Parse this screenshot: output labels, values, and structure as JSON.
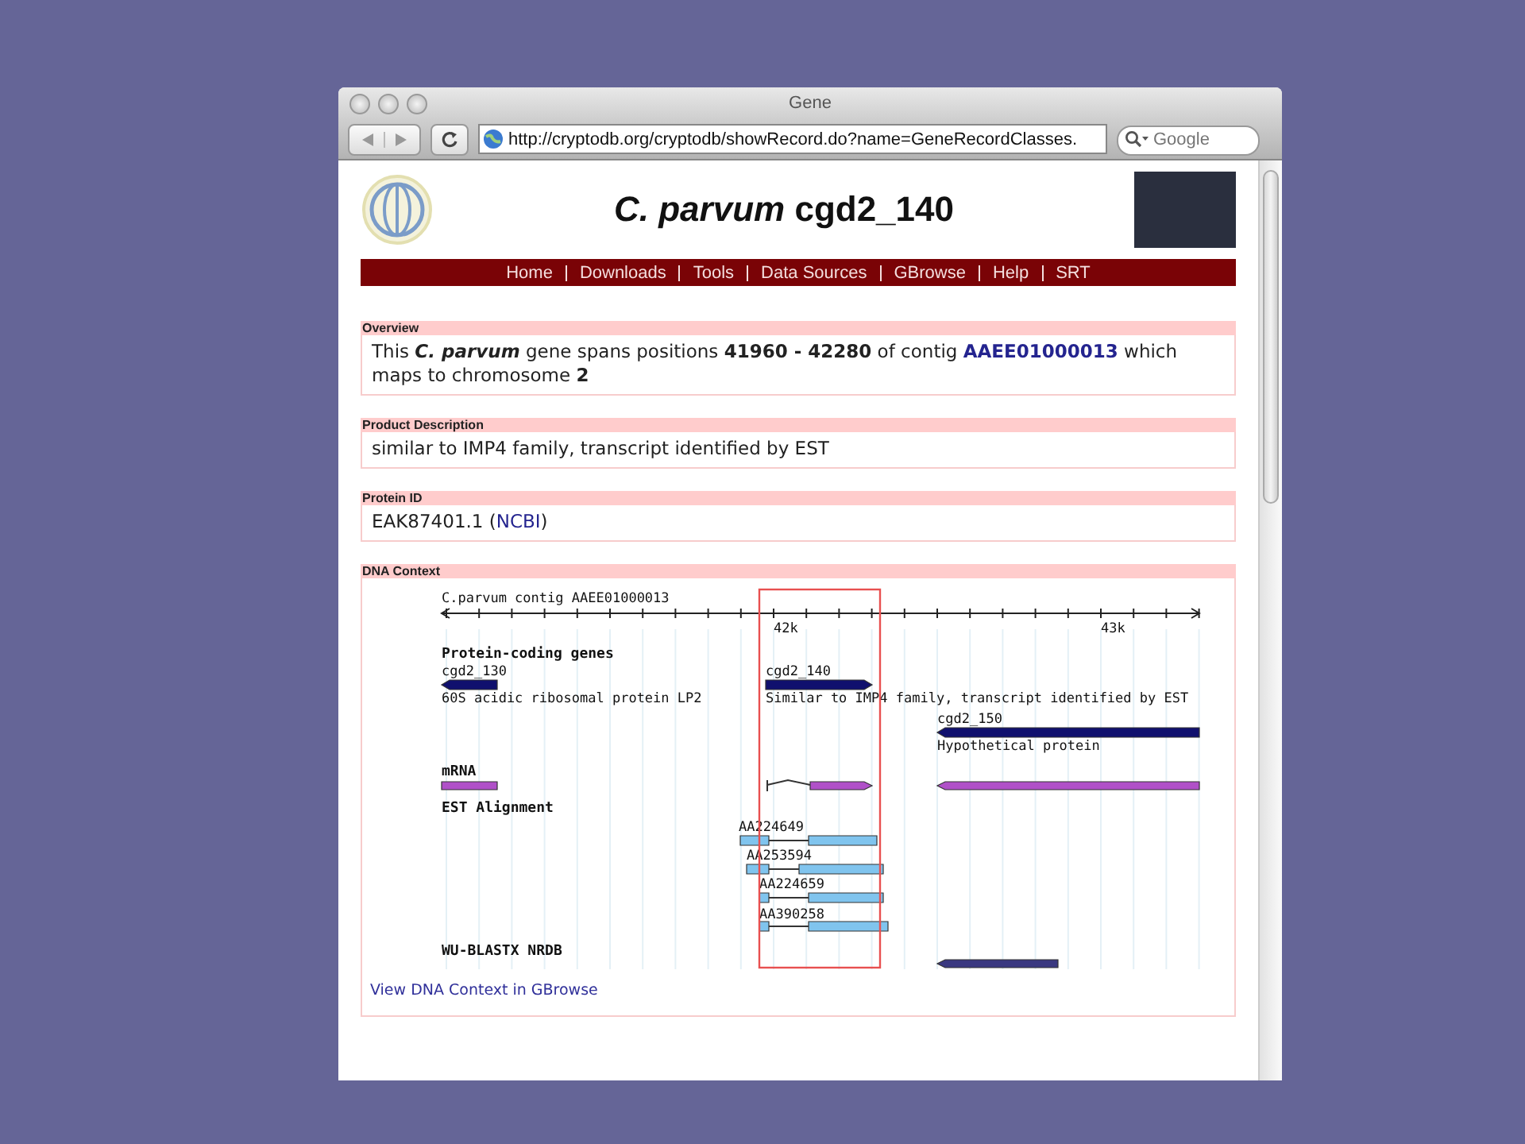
{
  "window": {
    "title": "Gene"
  },
  "toolbar": {
    "url": "http://cryptodb.org/cryptodb/showRecord.do?name=GeneRecordClasses.",
    "search_placeholder": "Google"
  },
  "page_title": "*C. parvum* cgd2_140",
  "nav": [
    "Home",
    "Downloads",
    "Tools",
    "Data Sources",
    "GBrowse",
    "Help",
    "SRT"
  ],
  "sections": [
    {
      "kind": "overview",
      "heading": "Overview",
      "before": "This *C. parvum* gene spans positions **41960 - 42280** of contig",
      "link": "AAEE01000013",
      "after": "which maps to chromosome **2**"
    },
    {
      "kind": "text",
      "heading": "Product Description",
      "text": "similar to IMP4 family, transcript identified by EST"
    },
    {
      "kind": "protein",
      "heading": "Protein ID",
      "before": "EAK87401.1 (",
      "link": "NCBI",
      "after": ")"
    },
    {
      "kind": "dna",
      "heading": "DNA Context",
      "contig": "C.parvum contig AAEE01000013",
      "axis_labels": [
        "42k",
        "43k"
      ],
      "tracks": [
        {
          "kind": "genes",
          "title": "Protein-coding genes",
          "features": [
            {
              "name": "cgd2_130",
              "description": "60S acidic ribosomal protein LP2"
            },
            {
              "name": "cgd2_140",
              "description": "Similar to IMP4 family, transcript identified by EST"
            },
            {
              "name": "cgd2_150",
              "description": "Hypothetical protein"
            }
          ]
        },
        {
          "kind": "mrna",
          "title": "mRNA"
        },
        {
          "kind": "est",
          "title": "EST Alignment",
          "features": [
            {
              "name": "AA224649"
            },
            {
              "name": "AA253594"
            },
            {
              "name": "AA224659"
            },
            {
              "name": "AA390258"
            }
          ]
        },
        {
          "kind": "blast",
          "title": "WU-BLASTX NRDB"
        }
      ],
      "link": "View DNA Context in GBrowse"
    }
  ]
}
